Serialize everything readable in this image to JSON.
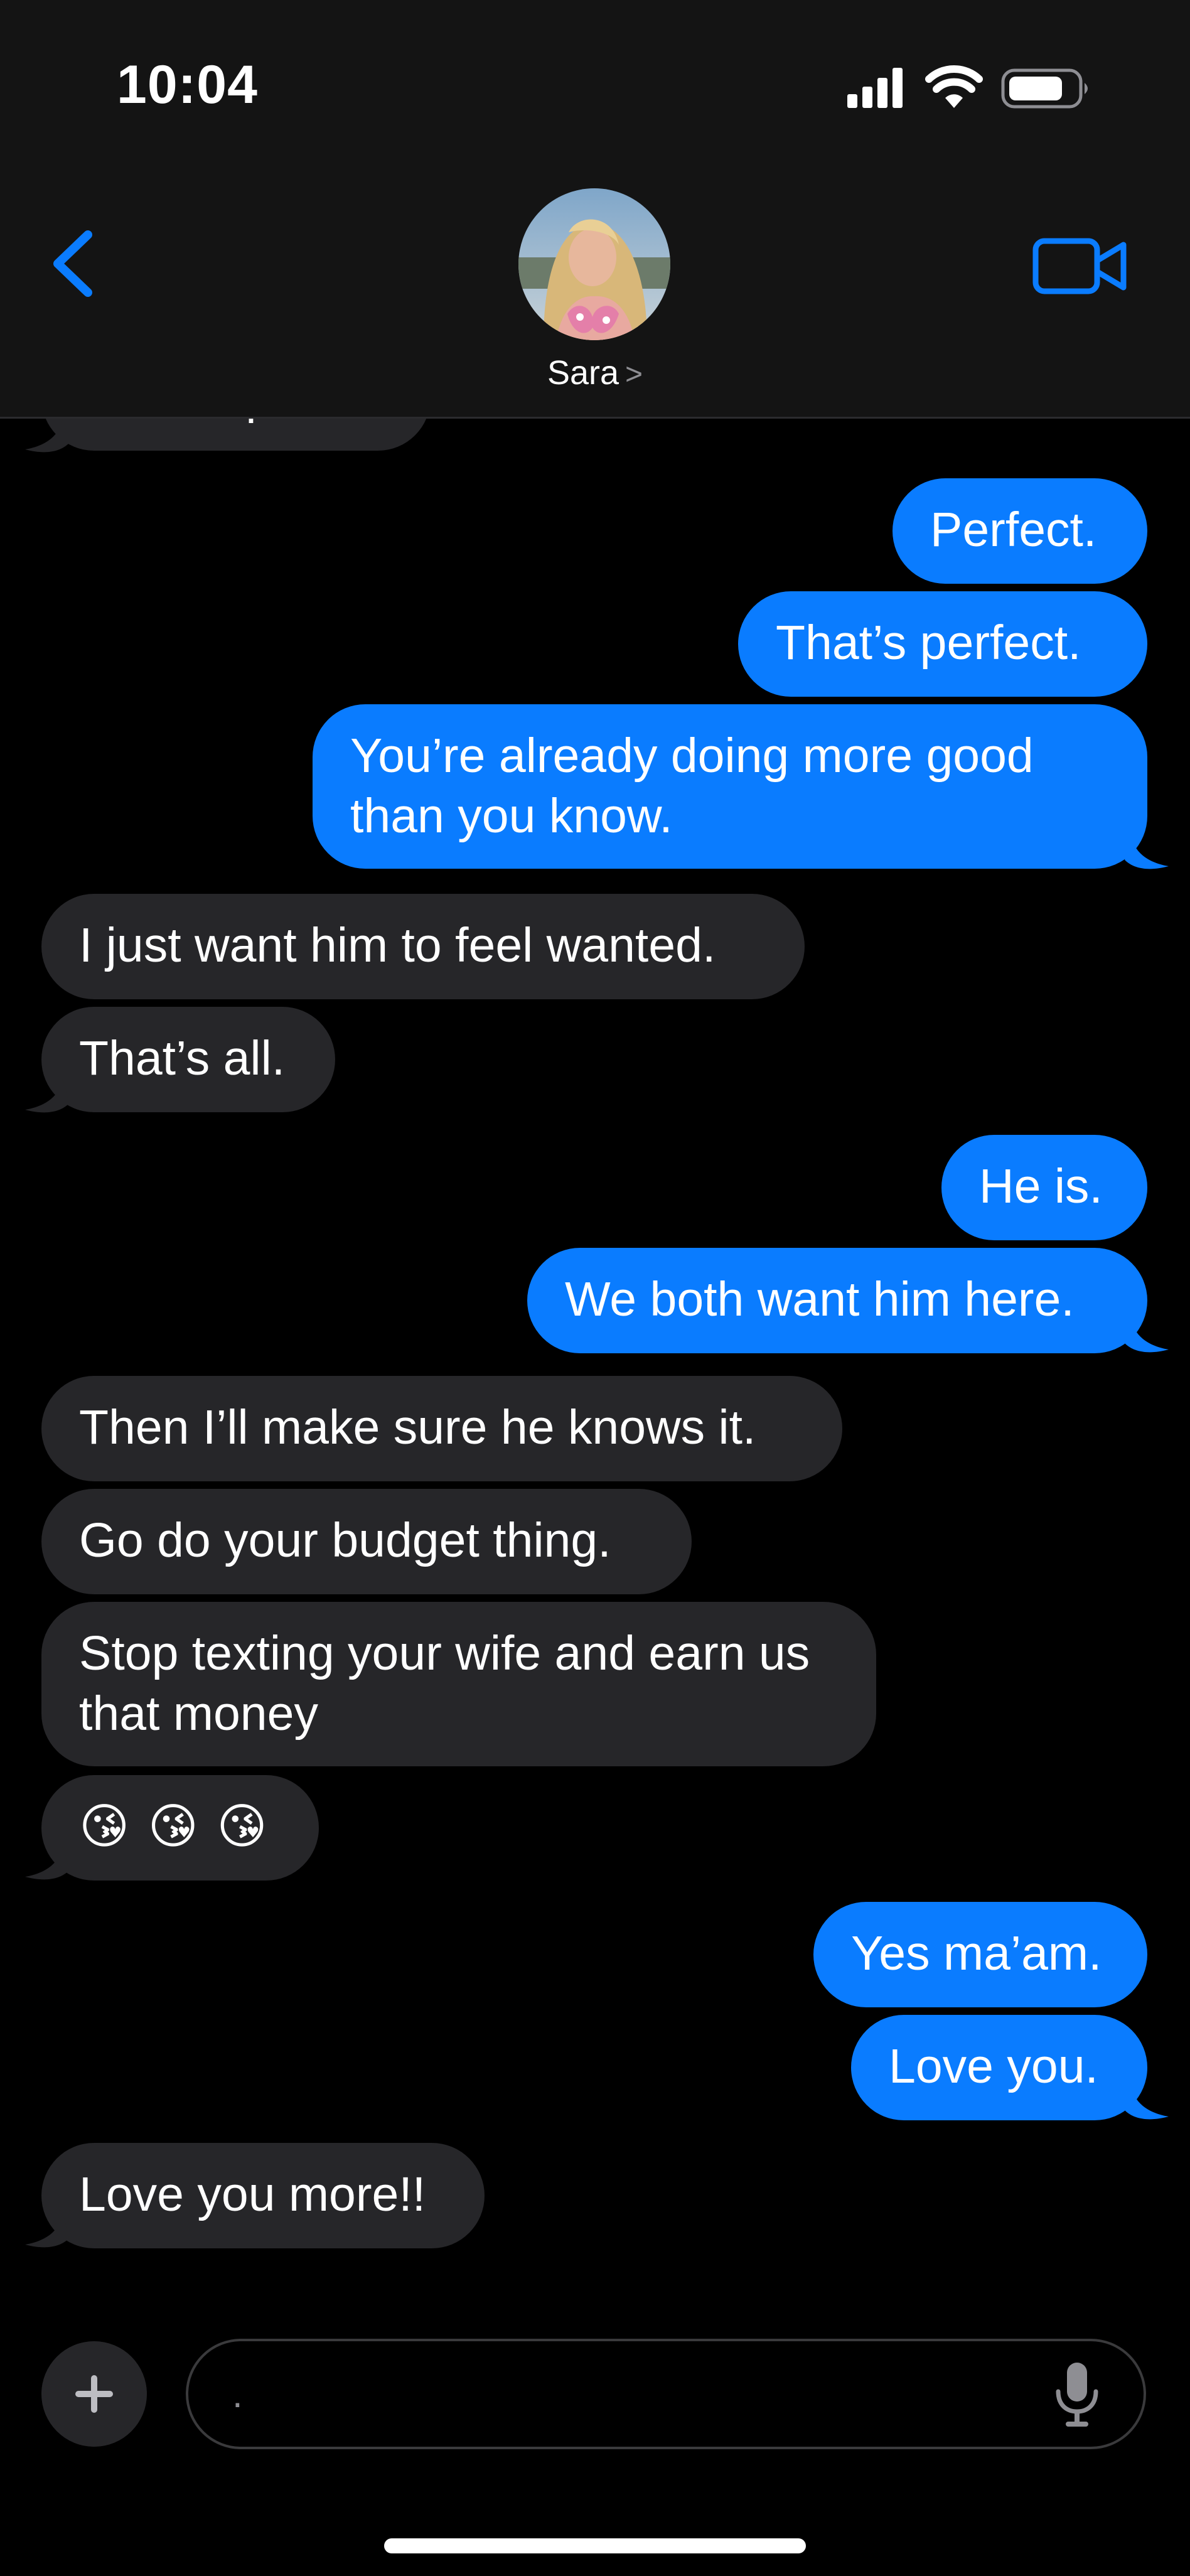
{
  "status_bar": {
    "time": "10:04"
  },
  "header": {
    "contact_name": "Sara",
    "name_chevron": ">",
    "back_icon": "chevron-left-icon",
    "video_icon": "video-camera-icon",
    "accent_color": "#0a7cff"
  },
  "thread": {
    "messages": [
      {
        "id": "m0",
        "direction": "incoming",
        "text": "For the pasta."
      },
      {
        "id": "m1",
        "direction": "outgoing",
        "text": "Perfect."
      },
      {
        "id": "m2",
        "direction": "outgoing",
        "text": "That’s perfect."
      },
      {
        "id": "m3",
        "direction": "outgoing",
        "text": "You’re already doing more good than you know."
      },
      {
        "id": "m4",
        "direction": "incoming",
        "text": "I just want him to feel wanted."
      },
      {
        "id": "m5",
        "direction": "incoming",
        "text": "That’s all."
      },
      {
        "id": "m6",
        "direction": "outgoing",
        "text": "He is."
      },
      {
        "id": "m7",
        "direction": "outgoing",
        "text": "We both want him here."
      },
      {
        "id": "m8",
        "direction": "incoming",
        "text": "Then I’ll make sure he knows it."
      },
      {
        "id": "m9",
        "direction": "incoming",
        "text": "Go do your budget thing."
      },
      {
        "id": "m10",
        "direction": "incoming",
        "text": "Stop texting your wife and earn us that money"
      },
      {
        "id": "m11",
        "direction": "incoming",
        "text": "😘 😘 😘"
      },
      {
        "id": "m12",
        "direction": "outgoing",
        "text": "Yes ma’am."
      },
      {
        "id": "m13",
        "direction": "outgoing",
        "text": "Love you."
      },
      {
        "id": "m14",
        "direction": "incoming",
        "text": "Love you more!!"
      }
    ],
    "incoming_color": "#262629",
    "outgoing_color": "#0a7cff"
  },
  "composer": {
    "input_value": ".",
    "plus_icon": "plus-icon",
    "mic_icon": "microphone-icon"
  }
}
